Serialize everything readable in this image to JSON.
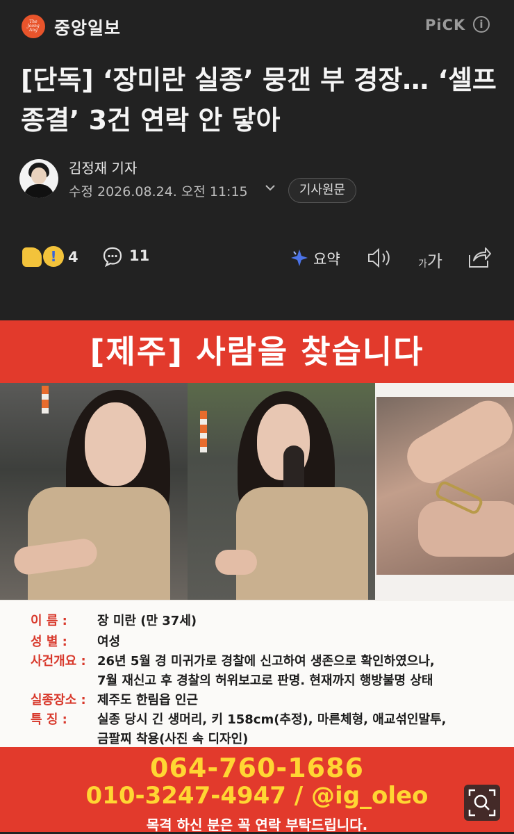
{
  "header": {
    "logo_text": [
      "The",
      "Joong",
      "Ang"
    ],
    "publisher": "중앙일보",
    "pick_label": "PiCK",
    "info_icon": "info-circle-icon"
  },
  "article": {
    "headline": "[단독] ‘장미란 실종’ 뭉갠 부 경장… ‘셀프 종결’ 3건 연락 안 닿아",
    "reporter": "김정재 기자",
    "updated": "수정 2026.08.24. 오전 11:15",
    "original_button": "기사원문"
  },
  "actions": {
    "reaction_count": "4",
    "comment_count": "11",
    "summary_label": "요약",
    "font_small": "가",
    "font_big": "가"
  },
  "poster": {
    "banner": "[제주] 사람을 찾습니다",
    "rows": [
      {
        "label": "이      름 :",
        "value": "장 미란 (만 37세)"
      },
      {
        "label": "성      별 :",
        "value": "여성"
      },
      {
        "label": "사건개요 :",
        "value": "26년 5월 경 미귀가로 경찰에 신고하여 생존으로 확인하였으나,"
      },
      {
        "label": "",
        "value": "7월 재신고 후 경찰의 허위보고로 판명. 현재까지 행방불명 상태"
      },
      {
        "label": "실종장소 :",
        "value": "제주도 한림읍 인근"
      },
      {
        "label": "특      징 :",
        "value": "실종 당시 긴 생머리, 키 158cm(추정), 마른체형, 애교섞인말투,"
      },
      {
        "label": "",
        "value": "금팔찌 착용(사진 속 디자인)"
      }
    ],
    "phone1": "064-760-1686",
    "phone2": "010-3247-4947 / @ig_oleo",
    "request": "목격 하신 분은 꼭 연락 부탁드립니다."
  },
  "colors": {
    "background": "#222222",
    "poster_red": "#e23a2c",
    "label_red": "#d8382b",
    "phone_yellow": "#ffd633"
  }
}
